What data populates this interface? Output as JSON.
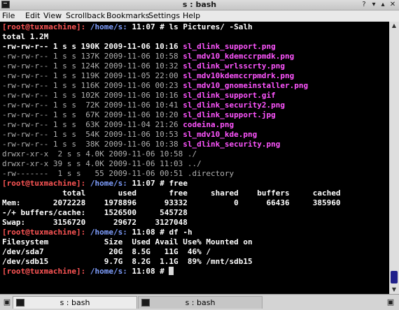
{
  "window": {
    "title": "s : bash"
  },
  "icons": {
    "app": "terminal-icon",
    "help": "question-icon",
    "minimize": "minimize-icon",
    "maximize": "maximize-icon",
    "close": "close-icon",
    "new_tab": "new-tab-icon",
    "close_tab": "close-tab-icon"
  },
  "menu": [
    "File",
    "Edit",
    "View",
    "Scrollback",
    "Bookmarks",
    "Settings",
    "Help"
  ],
  "prompt": {
    "user": "[root@tuxmachine]:",
    "path": "/home/s:"
  },
  "terminal": {
    "cmd1": {
      "time": "11:07",
      "command": "# ls Pictures/ -Salh"
    },
    "total": "total 1.2M",
    "listing": [
      {
        "meta": "-rw-rw-r-- 1 s s 190K 2009-11-06 10:16",
        "name": "sl_dlink_support.png",
        "emph": true
      },
      {
        "meta": "-rw-rw-r-- 1 s s 137K 2009-11-06 10:58",
        "name": "sl_mdv10_kdemccrpmdk.png"
      },
      {
        "meta": "-rw-rw-r-- 1 s s 124K 2009-11-06 10:32",
        "name": "sl_dlink_wrlsscrty.png"
      },
      {
        "meta": "-rw-rw-r-- 1 s s 119K 2009-11-05 22:00",
        "name": "sl_mdv10kdemccrpmdrk.png"
      },
      {
        "meta": "-rw-rw-r-- 1 s s 116K 2009-11-06 00:23",
        "name": "sl_mdv10_gnomeinstaller.png"
      },
      {
        "meta": "-rw-rw-r-- 1 s s 102K 2009-11-06 10:16",
        "name": "sl_dlink_support.gif"
      },
      {
        "meta": "-rw-rw-r-- 1 s s  72K 2009-11-06 10:41",
        "name": "sl_dlink_security2.png"
      },
      {
        "meta": "-rw-rw-r-- 1 s s  67K 2009-11-06 10:20",
        "name": "sl_dlink_support.jpg"
      },
      {
        "meta": "-rw-rw-r-- 1 s s  63K 2009-11-04 21:26",
        "name": "codeina.png"
      },
      {
        "meta": "-rw-rw-r-- 1 s s  54K 2009-11-06 10:53",
        "name": "sl_mdv10_kde.png"
      },
      {
        "meta": "-rw-rw-r-- 1 s s  38K 2009-11-06 10:38",
        "name": "sl_dlink_security.png"
      },
      {
        "meta": "drwxr-xr-x  2 s s 4.0K 2009-11-06 10:58",
        "name": "./"
      },
      {
        "meta": "drwxr-xr-x 39 s s 4.0K 2009-11-06 11:03",
        "name": "../"
      },
      {
        "meta": "-rw-------  1 s s   55 2009-11-06 00:51",
        "name": ".directory"
      }
    ],
    "cmd2": {
      "time": "11:07",
      "command": "# free"
    },
    "free_header": "             total       used       free     shared    buffers     cached",
    "free_mem": "Mem:       2072228    1978896      93332          0      66436     385960",
    "free_bc": "-/+ buffers/cache:    1526500     545728",
    "free_swap": "Swap:      3156720      29672    3127048",
    "cmd3": {
      "time": "11:08",
      "command": "# df -h"
    },
    "df_header": "Filesystem            Size  Used Avail Use% Mounted on",
    "df_rows": [
      "/dev/sda7              20G  8.5G   11G  46% /",
      "/dev/sdb15            9.7G  8.2G  1.1G  89% /mnt/sdb15"
    ],
    "cmd4": {
      "time": "11:08",
      "command": "#"
    }
  },
  "tabs": [
    {
      "label": "s : bash",
      "active": true
    },
    {
      "label": "s : bash",
      "active": false
    }
  ],
  "colors": {
    "prompt_user": "#ff5555",
    "prompt_path": "#7f9fff",
    "image_file": "#ff55ff",
    "terminal_bg": "#000000",
    "scrollbar_thumb": "#20208a"
  }
}
